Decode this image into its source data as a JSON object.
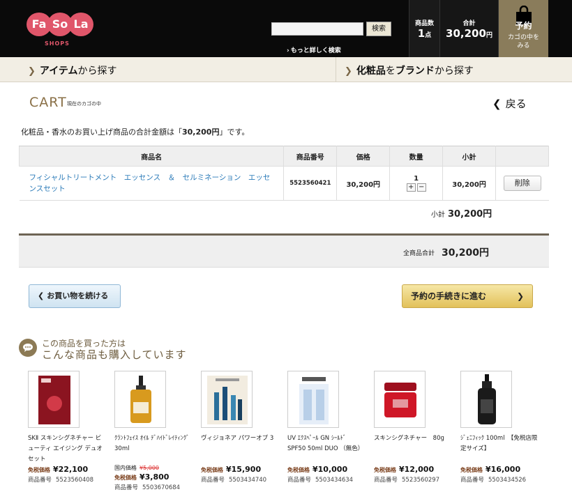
{
  "header": {
    "logo": {
      "fa": "Fa",
      "so": "So",
      "la": "La",
      "shops": "SHOPS"
    },
    "search_button": "検索",
    "more_search": "もっと詳しく検索",
    "qty_label": "商品数",
    "qty_value": "1",
    "qty_unit": "点",
    "total_label": "合計",
    "total_value": "30,200",
    "total_unit": "円",
    "cart_label": "予約",
    "cart_sub": "カゴの中を\nみる"
  },
  "nav": {
    "item_search": {
      "a": "アイテム",
      "b": "から探す"
    },
    "brand_search": {
      "a": "化粧品",
      "b": "を",
      "c": "ブランド",
      "d": "から探す"
    }
  },
  "page": {
    "title": "CART",
    "subtitle": "現在のカゴの中",
    "back": "戻る",
    "summary_prefix": "化粧品・香水のお買い上げ商品の合計金額は「",
    "summary_amount": "30,200円",
    "summary_suffix": "」です。"
  },
  "table": {
    "headers": [
      "商品名",
      "商品番号",
      "価格",
      "数量",
      "小計",
      ""
    ],
    "rows": [
      {
        "name": "フィシャルトリートメント　エッセンス　＆　セルミネーション　エッセンスセット",
        "code": "5523560421",
        "price": "30,200円",
        "qty": "1",
        "plus": "+",
        "minus": "−",
        "subtotal": "30,200円",
        "delete": "削除"
      }
    ],
    "subtotal_label": "小計",
    "subtotal_value": "30,200円",
    "grand_label": "全商品合計",
    "grand_value": "30,200円"
  },
  "buttons": {
    "continue": "お買い物を続ける",
    "proceed": "予約の手続きに進む"
  },
  "recommend": {
    "title1": "この商品を買った方は",
    "title2": "こんな商品も購入しています",
    "price_label": "免税価格",
    "domestic_label": "国内価格",
    "code_label": "商品番号",
    "products": [
      {
        "name": "SKⅡ スキンシグネチャー ビューティ エイジング デュオ セット",
        "price": "¥22,100",
        "code": "5523560408",
        "domestic": ""
      },
      {
        "name": "ｸﾗﾝﾄﾌｪｲｽ ｵｲﾙ ﾃﾞﾊｲﾄﾞﾚｲﾃｨﾝｸﾞ 30ml",
        "price": "¥3,800",
        "code": "5503670684",
        "domestic": "¥5,000"
      },
      {
        "name": "ヴィジョネア パワーオブ 3",
        "price": "¥15,900",
        "code": "5503434740",
        "domestic": ""
      },
      {
        "name": "UV ｴｸｽﾍﾟｰﾙ GN ｼｰﾙﾄﾞ SPF50 50ml DUO （無色）",
        "price": "¥10,000",
        "code": "5503434634",
        "domestic": ""
      },
      {
        "name": "スキンシグネチャー　80g",
        "price": "¥12,000",
        "code": "5523560297",
        "domestic": ""
      },
      {
        "name": "ｼﾞｪﾆﾌｨｯｸ 100ml　【免税店限定サイズ】",
        "price": "¥16,000",
        "code": "5503434526",
        "domestic": ""
      }
    ]
  }
}
